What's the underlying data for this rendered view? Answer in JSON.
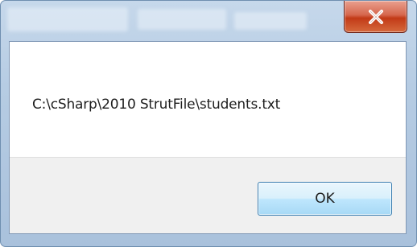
{
  "titlebar": {
    "close_icon": "close-icon",
    "close_button_color": "#c8391a"
  },
  "message": {
    "text": "C:\\cSharp\\2010 StrutFile\\students.txt"
  },
  "buttons": {
    "ok_label": "OK",
    "ok_accent": "#3c7fb1"
  }
}
